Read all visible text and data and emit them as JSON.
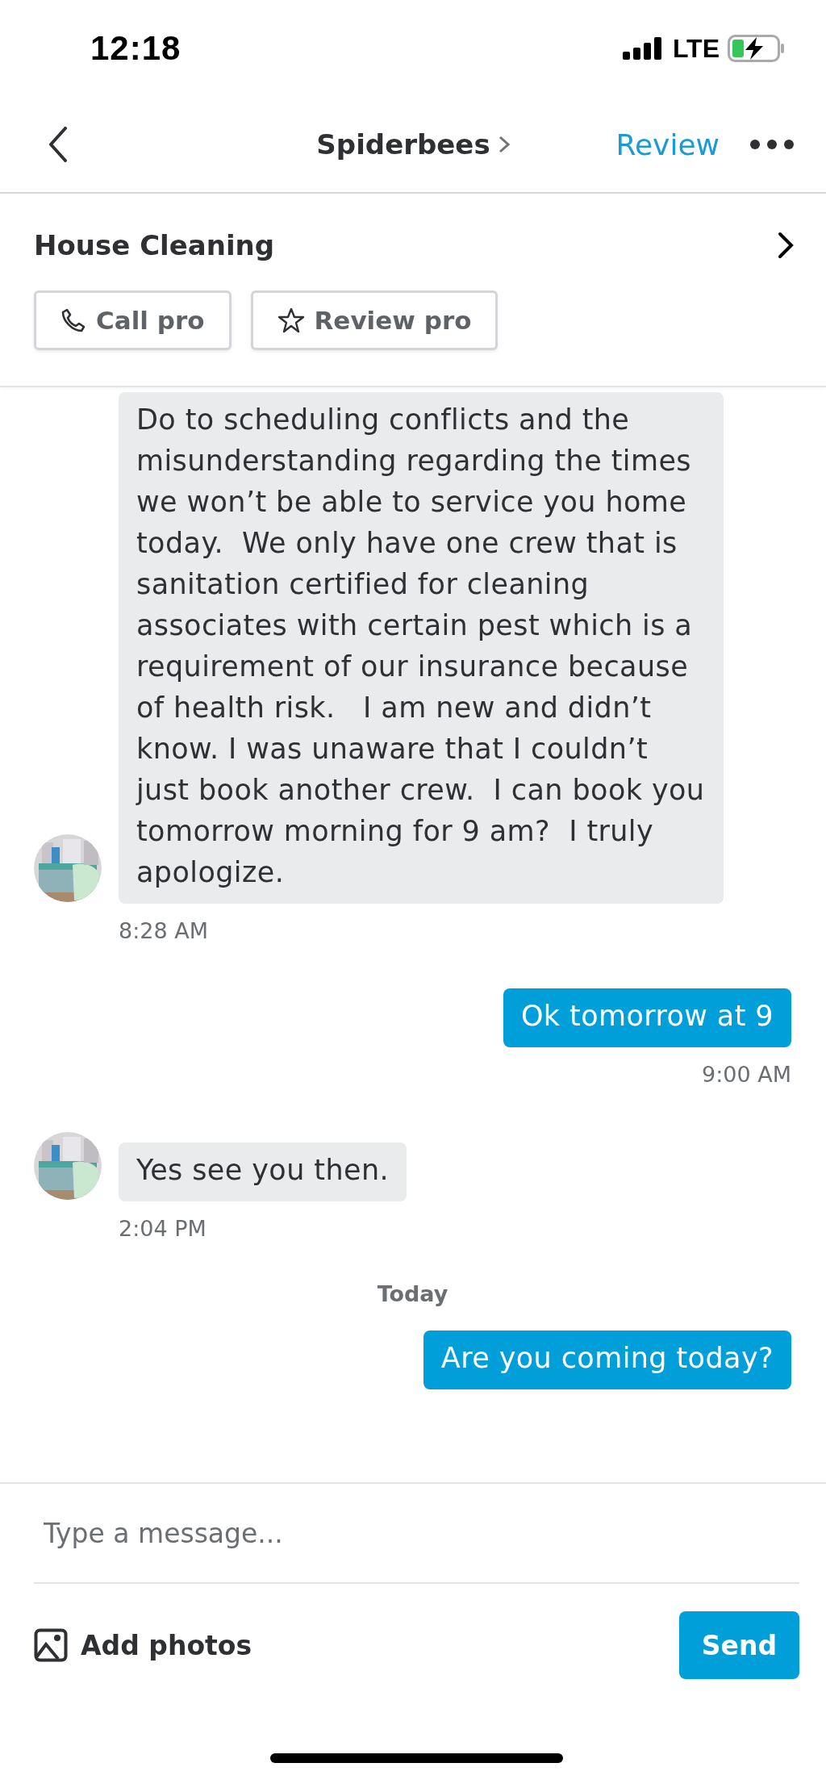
{
  "status_bar": {
    "time": "12:18",
    "network": "LTE"
  },
  "nav": {
    "title": "Spiderbees",
    "action": "Review"
  },
  "job": {
    "title": "House Cleaning",
    "buttons": [
      {
        "label": "Call pro",
        "kind": "phone"
      },
      {
        "label": "Review pro",
        "kind": "star"
      }
    ]
  },
  "messages": [
    {
      "kind": "incoming",
      "text": "Do to scheduling conflicts and the misunderstanding regarding the times we won’t be able to service you home today.  We only have one crew that is sanitation certified for cleaning associates with certain pest which is a requirement of our insurance because of health risk.   I am new and didn’t know. I was unaware that I couldn’t just book another crew.  I can book you tomorrow morning for 9 am?  I truly apologize.",
      "time": "8:28 AM"
    },
    {
      "kind": "outgoing",
      "text": "Ok tomorrow at 9",
      "time": "9:00 AM"
    },
    {
      "kind": "incoming",
      "text": "Yes see you then.",
      "time": "2:04 PM"
    },
    {
      "kind": "date",
      "text": "Today"
    },
    {
      "kind": "outgoing",
      "text": "Are you coming today?"
    }
  ],
  "composer": {
    "placeholder": "Type a message...",
    "add_photos": "Add photos",
    "send": "Send"
  }
}
